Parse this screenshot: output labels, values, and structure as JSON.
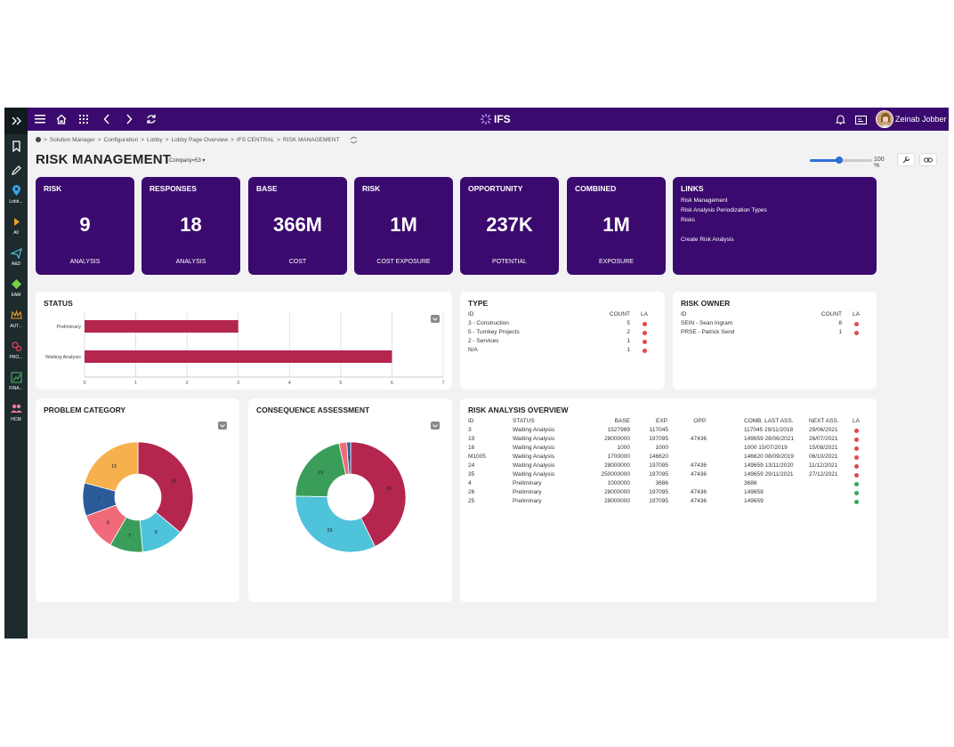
{
  "leftrail": {
    "items": [
      {
        "label": "",
        "icon": "expand-icon"
      },
      {
        "label": "",
        "icon": "bookmark-icon"
      },
      {
        "label": "",
        "icon": "pencil-icon"
      },
      {
        "label": "Lobb...",
        "icon": "location-icon"
      },
      {
        "label": "All",
        "icon": "play-icon"
      },
      {
        "label": "A&D",
        "icon": "airplane-icon"
      },
      {
        "label": "EAM",
        "icon": "diamond-icon"
      },
      {
        "label": "AUT...",
        "icon": "crown-icon"
      },
      {
        "label": "PRO...",
        "icon": "gears-icon"
      },
      {
        "label": "FINA...",
        "icon": "finance-icon"
      },
      {
        "label": "HCM",
        "icon": "people-icon"
      }
    ]
  },
  "topbar": {
    "logo": "IFS",
    "user": "Zeinab Jobber"
  },
  "breadcrumb": {
    "items": [
      "Solution Manager",
      "Configuration",
      "Lobby",
      "Lobby Page Overview",
      "IFS CENTRAL",
      "RISK MANAGEMENT"
    ],
    "sep": ">"
  },
  "page": {
    "title": "RISK MANAGEMENT",
    "context": "Company=53 ▾",
    "zoom": "100 %",
    "zoom_level": 0.47
  },
  "kpis": [
    {
      "title": "RISK",
      "value": "9",
      "sub": "ANALYSIS"
    },
    {
      "title": "RESPONSES",
      "value": "18",
      "sub": "ANALYSIS"
    },
    {
      "title": "BASE",
      "value": "366M",
      "sub": "COST"
    },
    {
      "title": "RISK",
      "value": "1M",
      "sub": "COST EXPOSURE"
    },
    {
      "title": "OPPORTUNITY",
      "value": "237K",
      "sub": "POTENTIAL"
    },
    {
      "title": "COMBINED",
      "value": "1M",
      "sub": "EXPOSURE"
    }
  ],
  "links": {
    "title": "LINKS",
    "items": [
      "Risk Management",
      "Risk Analysis Periodization Types",
      "Risks",
      "Create Risk Analysis"
    ]
  },
  "status": {
    "title": "STATUS",
    "chart_data": {
      "type": "bar",
      "orientation": "horizontal",
      "categories": [
        "Preliminary",
        "Waiting Analysis"
      ],
      "values": [
        3,
        6
      ],
      "xlim": [
        0,
        7
      ],
      "xticks": [
        "0",
        "1",
        "2",
        "3",
        "4",
        "5",
        "6",
        "7"
      ],
      "grid": true,
      "color": "#b5264f"
    }
  },
  "type_card": {
    "title": "TYPE",
    "headers": {
      "id": "ID",
      "count": "COUNT",
      "la": "LA"
    },
    "rows": [
      {
        "id": "3 - Construction",
        "count": "5",
        "la": "#e04a4a"
      },
      {
        "id": "5 - Turnkey Projects",
        "count": "2",
        "la": "#e04a4a"
      },
      {
        "id": "2 - Services",
        "count": "1",
        "la": "#e04a4a"
      },
      {
        "id": "N/A",
        "count": "1",
        "la": "#e04a4a"
      }
    ]
  },
  "owner_card": {
    "title": "RISK OWNER",
    "headers": {
      "id": "ID",
      "count": "COUNT",
      "la": "LA"
    },
    "rows": [
      {
        "id": "SEIN - Sean Ingram",
        "count": "8",
        "la": "#e04a4a"
      },
      {
        "id": "PRSE - Patrick Send",
        "count": "1",
        "la": "#e04a4a"
      }
    ]
  },
  "problem": {
    "title": "PROBLEM CATEGORY",
    "chart_data": {
      "type": "pie",
      "donut": true,
      "values": [
        26,
        9,
        7,
        8,
        7,
        15
      ],
      "labels": [
        "26",
        "9",
        "7",
        "8",
        "7",
        "15"
      ],
      "colors": [
        "#b5264f",
        "#4ec3da",
        "#3a9e5a",
        "#f06a7a",
        "#2c5b9a",
        "#f7b04e"
      ]
    }
  },
  "consequence": {
    "title": "CONSEQUENCE ASSESSMENT",
    "chart_data": {
      "type": "pie",
      "donut": true,
      "values": [
        38,
        29,
        19,
        2,
        1
      ],
      "labels": [
        "38",
        "29",
        "19",
        "",
        "1"
      ],
      "colors": [
        "#b5264f",
        "#4ec3da",
        "#3a9e5a",
        "#f06a7a",
        "#2c5b9a"
      ]
    }
  },
  "overview": {
    "title": "RISK ANALYSIS OVERVIEW",
    "headers": {
      "id": "ID",
      "status": "STATUS",
      "base": "BASE",
      "exp": "EXP.",
      "opp": "OPP.",
      "comb": "COMB. LAST ASS.",
      "next": "NEXT ASS.",
      "la": "LA"
    },
    "rows": [
      {
        "id": "3",
        "status": "Waiting Analysis",
        "base": "1527989",
        "exp": "117045",
        "opp": "",
        "comb": "117045 29/11/2018",
        "next": "29/06/2021",
        "la": "#e04a4a"
      },
      {
        "id": "19",
        "status": "Waiting Analysis",
        "base": "28000000",
        "exp": "197095",
        "opp": "47436",
        "comb": "149659 28/06/2021",
        "next": "26/07/2021",
        "la": "#e04a4a"
      },
      {
        "id": "16",
        "status": "Waiting Analysis",
        "base": "1000",
        "exp": "1000",
        "opp": "",
        "comb": "1000 15/07/2019",
        "next": "15/08/2021",
        "la": "#e04a4a"
      },
      {
        "id": "M1005",
        "status": "Waiting Analysis",
        "base": "1700000",
        "exp": "146620",
        "opp": "",
        "comb": "146620 08/09/2019",
        "next": "06/10/2021",
        "la": "#e04a4a"
      },
      {
        "id": "24",
        "status": "Waiting Analysis",
        "base": "28000000",
        "exp": "197095",
        "opp": "47436",
        "comb": "149659 13/11/2020",
        "next": "11/12/2021",
        "la": "#e04a4a"
      },
      {
        "id": "35",
        "status": "Waiting Analysis",
        "base": "250000000",
        "exp": "197095",
        "opp": "47436",
        "comb": "149659 29/11/2021",
        "next": "27/12/2021",
        "la": "#e04a4a"
      },
      {
        "id": "4",
        "status": "Preliminary",
        "base": "1000000",
        "exp": "3686",
        "opp": "",
        "comb": "3686",
        "next": "",
        "la": "#3aa65a"
      },
      {
        "id": "26",
        "status": "Preliminary",
        "base": "28000000",
        "exp": "197095",
        "opp": "47436",
        "comb": "149659",
        "next": "",
        "la": "#3aa65a"
      },
      {
        "id": "25",
        "status": "Preliminary",
        "base": "28000000",
        "exp": "197095",
        "opp": "47436",
        "comb": "149659",
        "next": "",
        "la": "#3aa65a"
      }
    ]
  }
}
